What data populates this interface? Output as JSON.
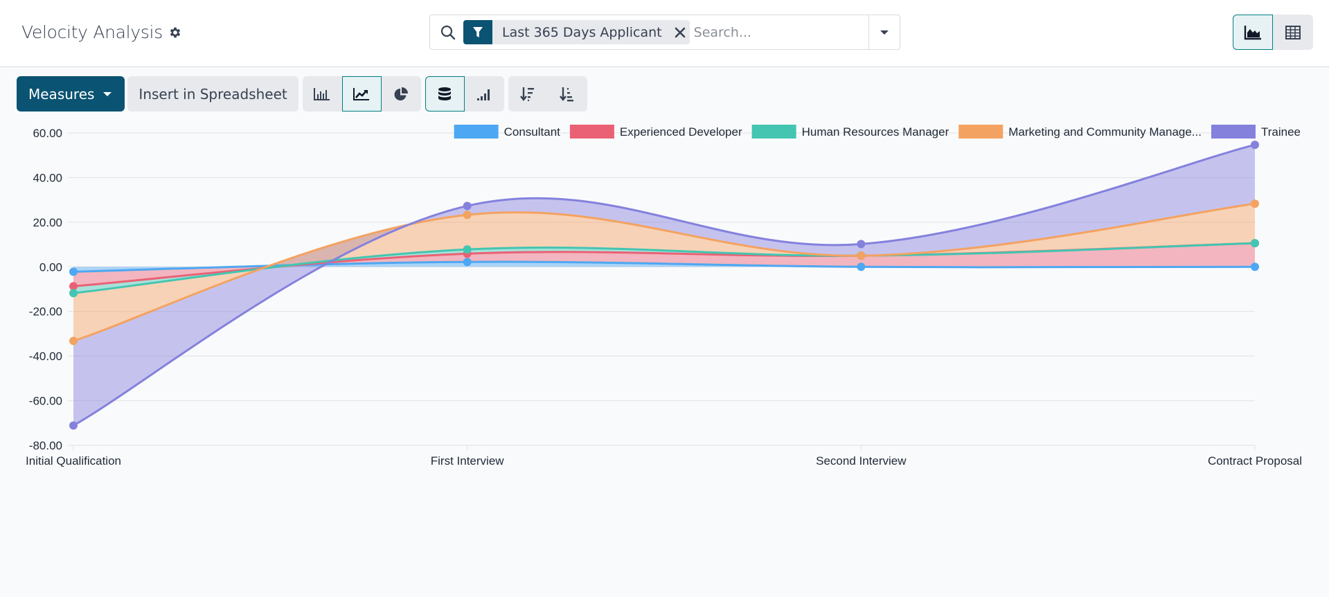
{
  "header": {
    "title": "Velocity Analysis",
    "title_icon": "gear-icon"
  },
  "search": {
    "facet_icon": "filter-icon",
    "facet_label": "Last 365 Days Applicant",
    "facet_remove_icon": "close-icon",
    "placeholder": "Search...",
    "value": "",
    "toggle_icon": "caret-down-icon"
  },
  "view_switcher": [
    {
      "name": "graph-view",
      "icon": "area-chart-icon",
      "active": true
    },
    {
      "name": "pivot-view",
      "icon": "table-icon",
      "active": false
    }
  ],
  "toolbar": {
    "measures_label": "Measures",
    "insert_label": "Insert in Spreadsheet",
    "chart_types": [
      {
        "name": "bar-chart",
        "icon": "bar-chart-icon",
        "active": false
      },
      {
        "name": "line-chart",
        "icon": "line-chart-icon",
        "active": true
      },
      {
        "name": "pie-chart",
        "icon": "pie-chart-icon",
        "active": false
      }
    ],
    "mode_buttons": [
      {
        "name": "stacked",
        "icon": "database-icon",
        "active": true
      },
      {
        "name": "cumulative",
        "icon": "signal-icon",
        "active": false
      }
    ],
    "sort_buttons": [
      {
        "name": "sort-descending",
        "icon": "sort-amount-down-icon"
      },
      {
        "name": "sort-ascending",
        "icon": "sort-amount-up-icon"
      }
    ]
  },
  "chart_data": {
    "type": "area",
    "stacked": true,
    "title": "",
    "xlabel": "",
    "ylabel": "",
    "categories": [
      "Initial Qualification",
      "First Interview",
      "Second Interview",
      "Contract Proposal"
    ],
    "ylim": [
      -80,
      60
    ],
    "yticks": [
      60,
      40,
      20,
      0,
      -20,
      -40,
      -60,
      -80
    ],
    "ytick_labels": [
      "60.00",
      "40.00",
      "20.00",
      "0.00",
      "-20.00",
      "-40.00",
      "-60.00",
      "-80.00"
    ],
    "grid": true,
    "legend_position": "top-right",
    "series": [
      {
        "name": "Consultant",
        "color": "#4ea7f2",
        "values": [
          -2.2,
          2.2,
          0,
          0
        ]
      },
      {
        "name": "Experienced Developer",
        "color": "#ea6175",
        "values": [
          -6.5,
          3.7,
          5.0,
          10.6
        ]
      },
      {
        "name": "Human Resources Manager",
        "color": "#43c5b1",
        "values": [
          -3.1,
          1.9,
          0,
          0
        ]
      },
      {
        "name": "Marketing and Community Manage...",
        "color": "#f4a261",
        "values": [
          -21.4,
          15.5,
          0,
          17.7
        ]
      },
      {
        "name": "Trainee",
        "color": "#8481dd",
        "values": [
          -37.9,
          4.0,
          5.2,
          26.4
        ]
      }
    ]
  }
}
